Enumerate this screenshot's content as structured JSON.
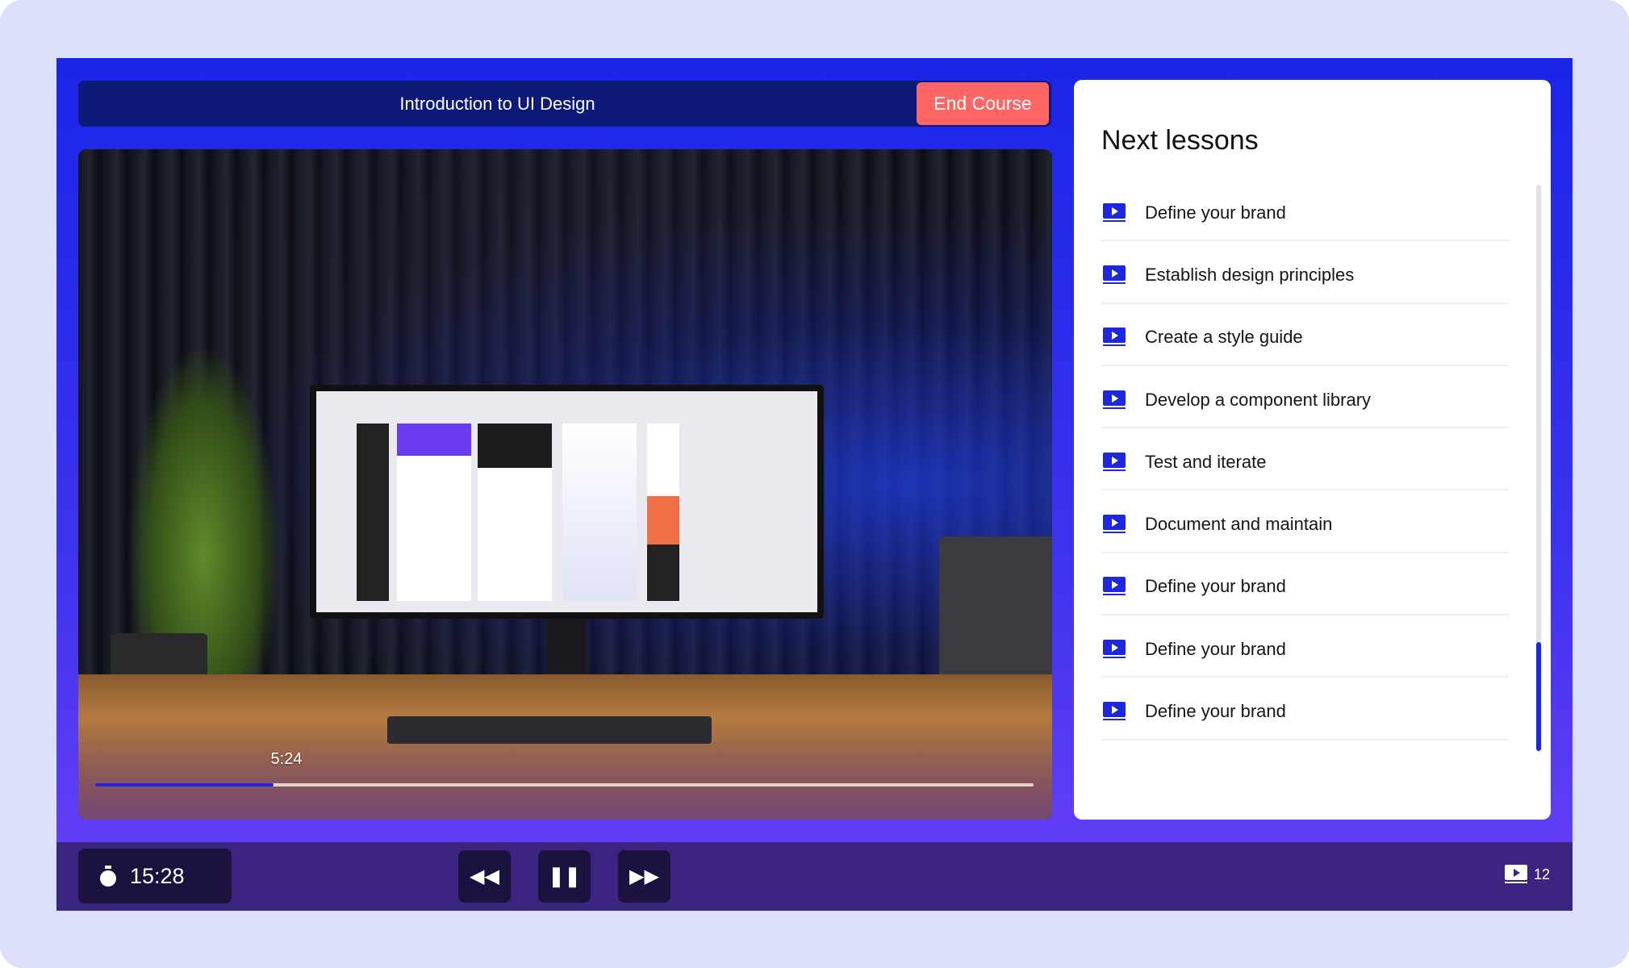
{
  "header": {
    "title": "Introduction to UI Design",
    "end_course_label": "End Course"
  },
  "video": {
    "current_time": "5:24",
    "progress_percent": 19
  },
  "sidebar": {
    "title": "Next lessons",
    "items": [
      {
        "label": "Define your brand"
      },
      {
        "label": "Establish design principles"
      },
      {
        "label": "Create a style guide"
      },
      {
        "label": "Develop a component library"
      },
      {
        "label": "Test and iterate"
      },
      {
        "label": "Document and maintain"
      },
      {
        "label": "Define your brand"
      },
      {
        "label": "Define your brand"
      },
      {
        "label": "Define your brand"
      }
    ]
  },
  "footer": {
    "timer": "15:28",
    "lesson_count": "12",
    "controls": {
      "rewind": "rewind-icon",
      "pause": "pause-icon",
      "forward": "fast-forward-icon"
    }
  },
  "colors": {
    "accent": "#1d26e0",
    "end_button": "#fe6565",
    "footer_bg": "#3b2480",
    "header_bg": "#0e1a78"
  }
}
